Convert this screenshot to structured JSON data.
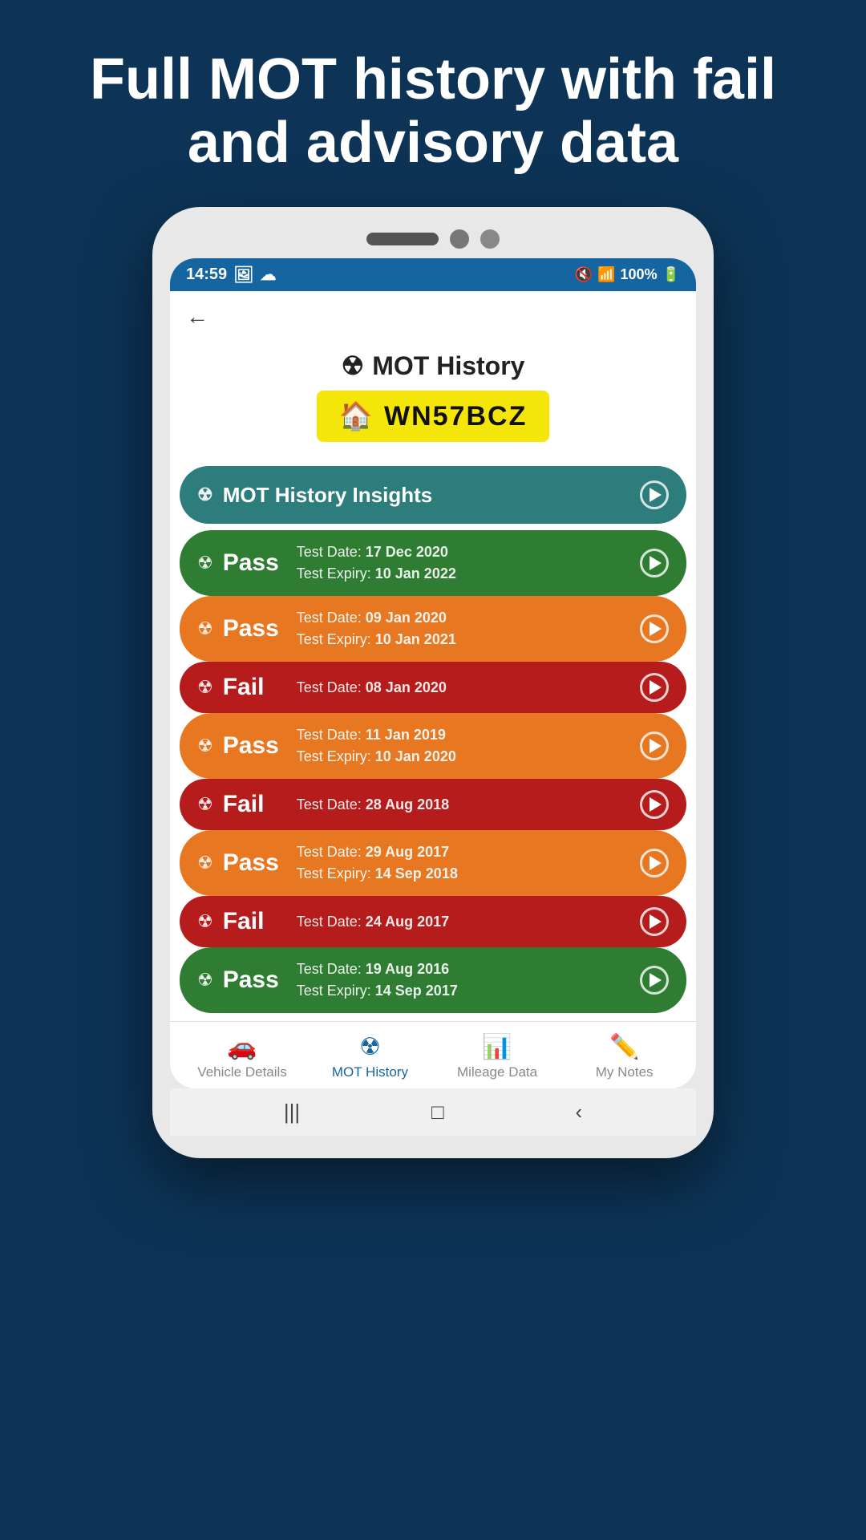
{
  "hero": {
    "title": "Full MOT history with fail and advisory data"
  },
  "statusBar": {
    "time": "14:59",
    "battery": "100%"
  },
  "appHeader": {
    "backLabel": "←"
  },
  "pageTitle": {
    "icon": "☢",
    "label": "MOT History"
  },
  "plate": {
    "icon": "🏠",
    "text": "WN57BCZ"
  },
  "insights": {
    "icon": "☢",
    "label": "MOT History Insights"
  },
  "motRecords": [
    {
      "type": "Pass",
      "colorClass": "pass-green",
      "testDateLabel": "Test Date:",
      "testDate": "17 Dec 2020",
      "expiryLabel": "Test Expiry:",
      "expiryDate": "10 Jan 2022"
    },
    {
      "type": "Pass",
      "colorClass": "pass-orange",
      "testDateLabel": "Test Date:",
      "testDate": "09 Jan 2020",
      "expiryLabel": "Test Expiry:",
      "expiryDate": "10 Jan 2021"
    },
    {
      "type": "Fail",
      "colorClass": "fail-red",
      "testDateLabel": "Test Date:",
      "testDate": "08 Jan 2020",
      "expiryLabel": null,
      "expiryDate": null
    },
    {
      "type": "Pass",
      "colorClass": "pass-orange",
      "testDateLabel": "Test Date:",
      "testDate": "11 Jan 2019",
      "expiryLabel": "Test Expiry:",
      "expiryDate": "10 Jan 2020"
    },
    {
      "type": "Fail",
      "colorClass": "fail-red",
      "testDateLabel": "Test Date:",
      "testDate": "28 Aug 2018",
      "expiryLabel": null,
      "expiryDate": null
    },
    {
      "type": "Pass",
      "colorClass": "pass-orange",
      "testDateLabel": "Test Date:",
      "testDate": "29 Aug 2017",
      "expiryLabel": "Test Expiry:",
      "expiryDate": "14 Sep 2018"
    },
    {
      "type": "Fail",
      "colorClass": "fail-red",
      "testDateLabel": "Test Date:",
      "testDate": "24 Aug 2017",
      "expiryLabel": null,
      "expiryDate": null
    },
    {
      "type": "Pass",
      "colorClass": "pass-green",
      "testDateLabel": "Test Date:",
      "testDate": "19 Aug 2016",
      "expiryLabel": "Test Expiry:",
      "expiryDate": "14 Sep 2017"
    }
  ],
  "tabBar": {
    "tabs": [
      {
        "id": "vehicle-details",
        "label": "Vehicle Details",
        "icon": "🚗",
        "active": false
      },
      {
        "id": "mot-history",
        "label": "MOT History",
        "icon": "☢",
        "active": true
      },
      {
        "id": "mileage-data",
        "label": "Mileage Data",
        "icon": "📊",
        "active": false
      },
      {
        "id": "my-notes",
        "label": "My Notes",
        "icon": "✏️",
        "active": false
      }
    ]
  },
  "homeBar": {
    "back": "‹",
    "home": "□",
    "recents": "|||"
  }
}
